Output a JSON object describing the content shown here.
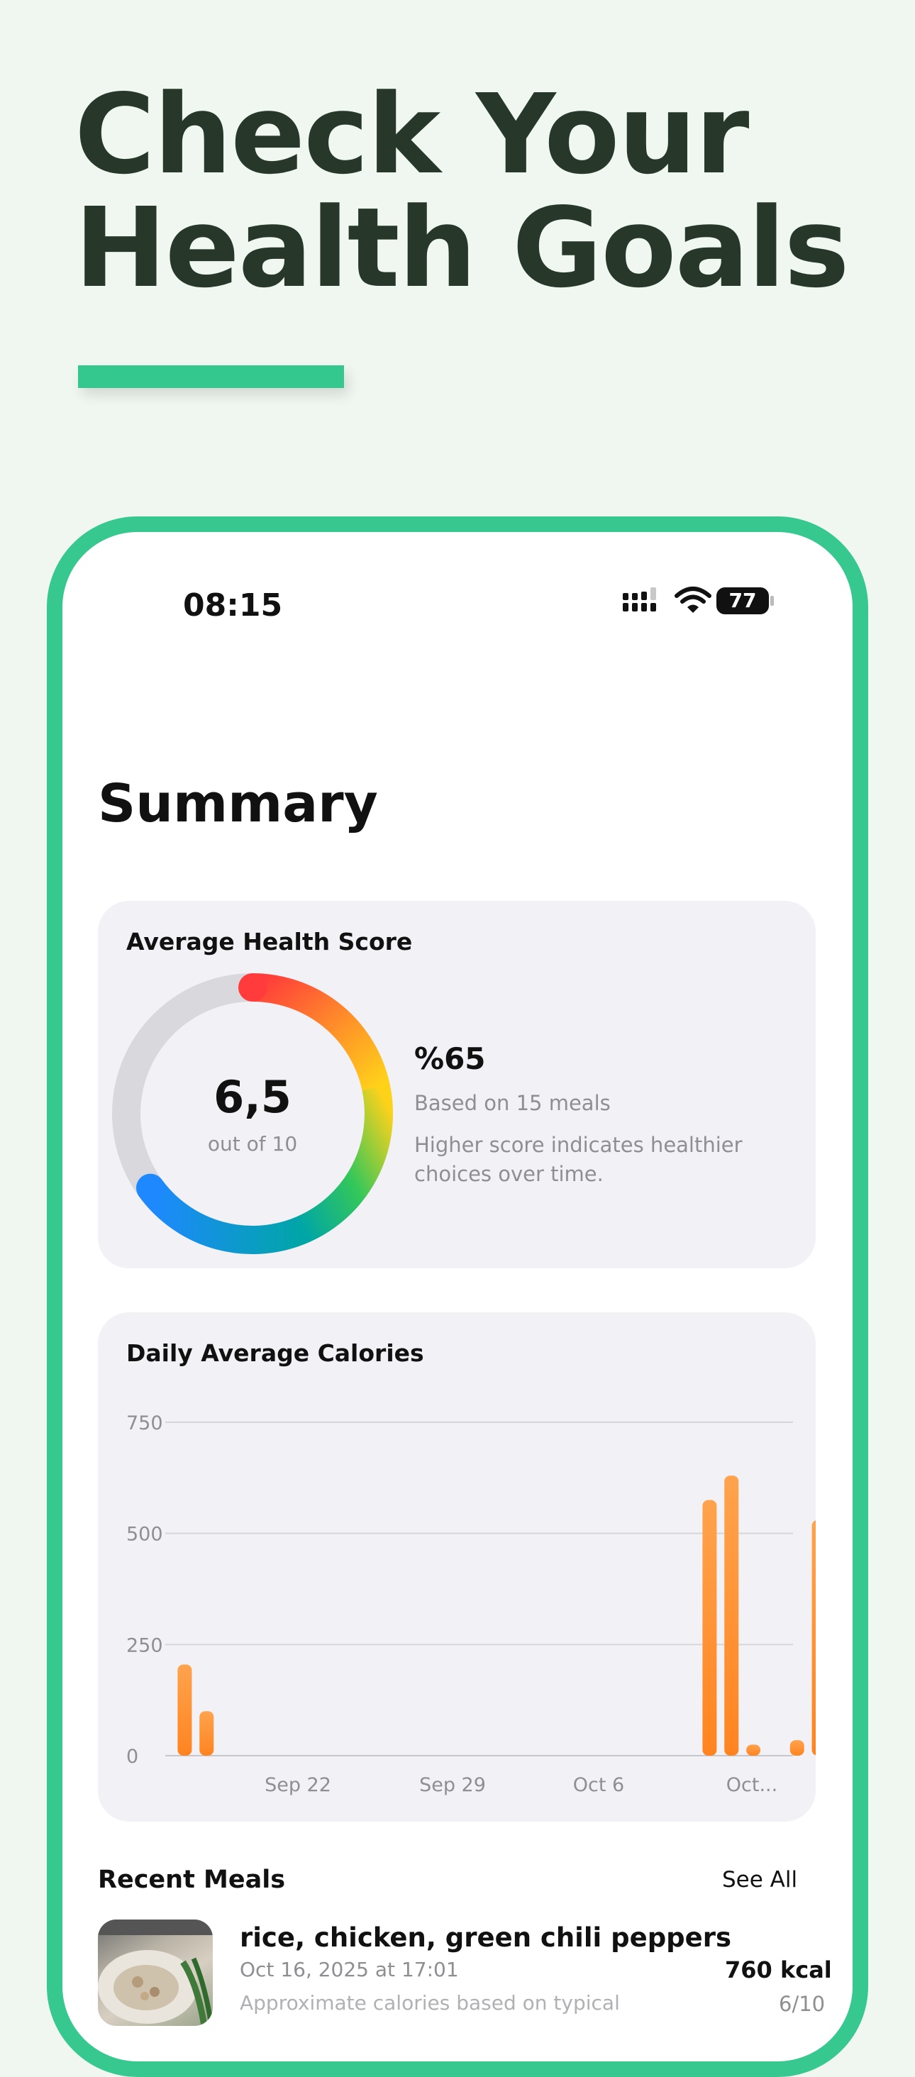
{
  "headline": {
    "line1": "Check Your",
    "line2": "Health Goals"
  },
  "colors": {
    "accent": "#35c88e",
    "headline": "#27372a",
    "bar": "#ff8c2a",
    "card": "#f1f1f6"
  },
  "status_bar": {
    "time": "08:15",
    "battery": "77",
    "icons": [
      "cellular-signal-icon",
      "wifi-icon",
      "battery-icon"
    ]
  },
  "summary": {
    "title": "Summary"
  },
  "health_score": {
    "title": "Average Health Score",
    "score": "6,5",
    "out_of": "out of 10",
    "percent": "%65",
    "based_on": "Based on 15 meals",
    "explanation": "Higher score indicates healthier choices over time.",
    "fraction": 0.65
  },
  "chart_data": {
    "type": "bar",
    "title": "Daily Average Calories",
    "xlabel": "",
    "ylabel": "",
    "ylim": [
      0,
      750
    ],
    "yticks": [
      0,
      250,
      500,
      750
    ],
    "xtick_labels": [
      "Sep 22",
      "Sep 29",
      "Oct 6",
      "Oct..."
    ],
    "grid": true,
    "values": [
      205,
      100,
      0,
      0,
      0,
      0,
      0,
      0,
      0,
      0,
      0,
      0,
      0,
      0,
      0,
      0,
      0,
      0,
      0,
      0,
      0,
      0,
      0,
      0,
      575,
      630,
      25,
      0,
      35,
      530
    ]
  },
  "recent_meals": {
    "title": "Recent Meals",
    "see_all": "See All",
    "items": [
      {
        "name": "rice, chicken, green chili peppers",
        "date": "Oct 16, 2025 at 17:01",
        "note": "Approximate calories based on typical",
        "kcal": "760 kcal",
        "score": "6/10"
      }
    ]
  }
}
